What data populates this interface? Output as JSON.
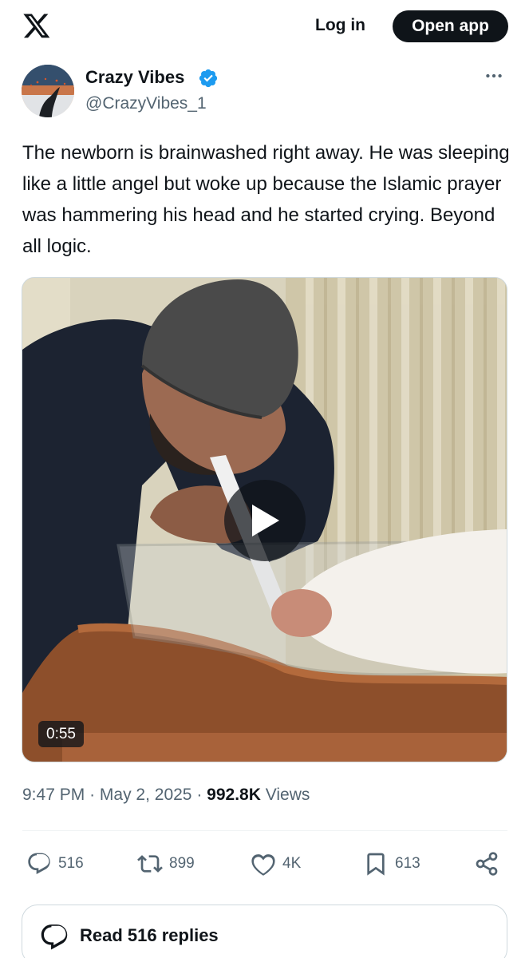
{
  "header": {
    "logo_icon": "x-logo-icon",
    "login_label": "Log in",
    "open_app_label": "Open app"
  },
  "author": {
    "name": "Crazy Vibes",
    "handle": "@CrazyVibes_1",
    "verified_color": "#1d9bf0"
  },
  "tweet": {
    "text": "The newborn is brainwashed right away. He was sleeping like a little angel but woke up because the Islamic prayer was hammering his head and he started crying. Beyond all logic.",
    "video_duration": "0:55"
  },
  "meta": {
    "time": "9:47 PM",
    "separator": "·",
    "date": "May 2, 2025",
    "views_count": "992.8K",
    "views_label": "Views"
  },
  "actions": {
    "replies": "516",
    "reposts": "899",
    "likes": "4K",
    "bookmarks": "613"
  },
  "replies_button": {
    "label": "Read 516 replies"
  }
}
